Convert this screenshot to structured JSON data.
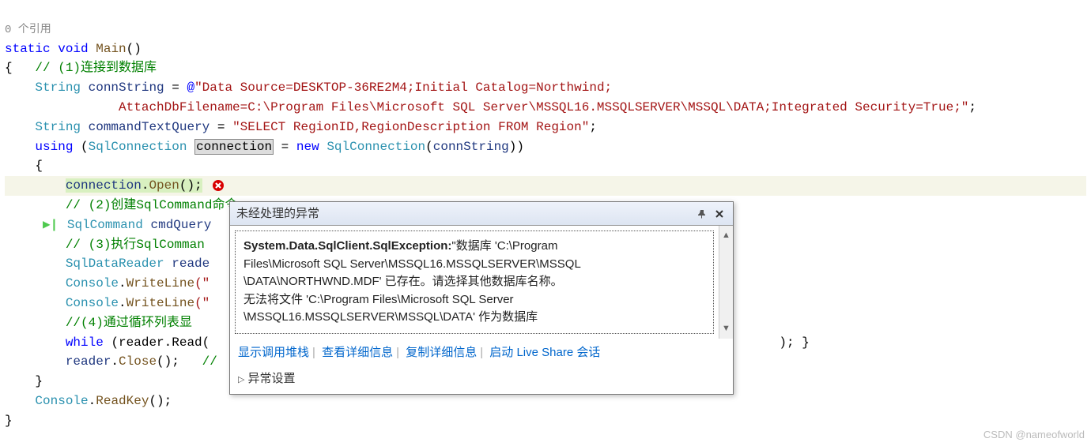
{
  "references": "0 个引用",
  "code": {
    "static": "static",
    "void": "void",
    "Main": "Main",
    "parens": "()",
    "lbrace": "{",
    "comment1": "// (1)连接到数据库",
    "String": "String",
    "connStringVar": "connString",
    "eq": " = ",
    "at": "@",
    "connStr1": "\"Data Source=DESKTOP-36RE2M4;Initial Catalog=Northwind;",
    "connStr2": "AttachDbFilename=C:\\Program Files\\Microsoft SQL Server\\MSSQL16.MSSQLSERVER\\MSSQL\\DATA;Integrated Security=True;\"",
    "semi": ";",
    "commandTextVar": "commandTextQuery",
    "selectStr": "\"SELECT RegionID,RegionDescription FROM Region\"",
    "using": "using",
    "SqlConnection": "SqlConnection",
    "connectionVar": "connection",
    "new": "new",
    "connOpen": "connection",
    "dot": ".",
    "Open": "Open",
    "comment2": "// (2)创建SqlCommand命令",
    "SqlCommand": "SqlCommand",
    "cmdQueryVar": "cmdQuery",
    "comment3": "// (3)执行SqlComman",
    "SqlDataReader": "SqlDataReader",
    "readerVar": "reade",
    "Console": "Console",
    "WriteLine": "WriteLine",
    "wlArg": "(\"",
    "comment4": "//(4)通过循环列表显",
    "while": "while",
    "readerRead": "(reader.Read(",
    "readerClose": "reader",
    "Close": "Close",
    "closeComment": "//",
    "ReadKey": "ReadKey",
    "rbrace": "}",
    "rparenSemiBrace": "); }"
  },
  "tooltip": {
    "title": "未经处理的异常",
    "exceptionBold": "System.Data.SqlClient.SqlException:",
    "msgLine1": "\"数据库 'C:\\Program",
    "msgLine2": "Files\\Microsoft SQL Server\\MSSQL16.MSSQLSERVER\\MSSQL",
    "msgLine3": "\\DATA\\NORTHWND.MDF' 已存在。请选择其他数据库名称。",
    "msgLine4": "无法将文件 'C:\\Program Files\\Microsoft SQL Server",
    "msgLine5": "\\MSSQL16.MSSQLSERVER\\MSSQL\\DATA' 作为数据库",
    "links": {
      "callstack": "显示调用堆栈",
      "details": "查看详细信息",
      "copy": "复制详细信息",
      "liveshare": "启动 Live Share 会话"
    },
    "settings": "异常设置"
  },
  "watermark": "CSDN @nameofworld"
}
